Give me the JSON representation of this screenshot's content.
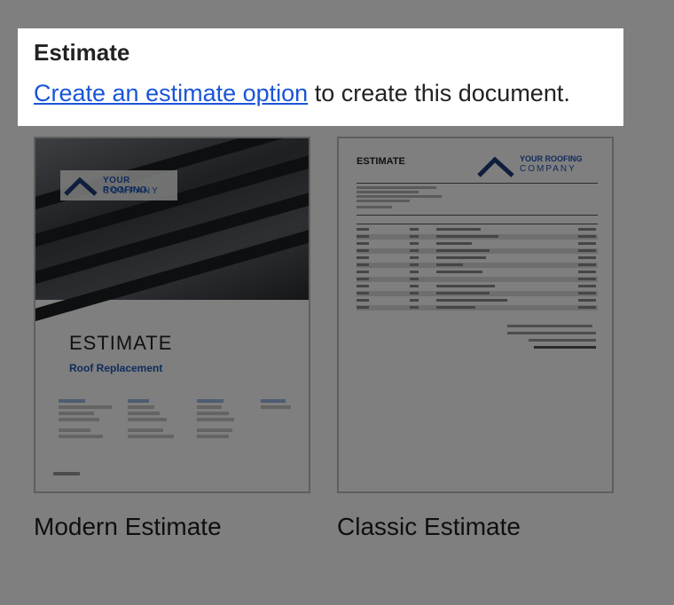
{
  "callout": {
    "title": "Estimate",
    "link_text": "Create an estimate option",
    "rest_text": " to create this document."
  },
  "templates": [
    {
      "name": "Modern Estimate"
    },
    {
      "name": "Classic Estimate"
    }
  ],
  "modern_preview": {
    "logo_line1": "YOUR ROOFING",
    "logo_line2": "COMPANY",
    "title": "ESTIMATE",
    "subtitle": "Roof Replacement"
  },
  "classic_preview": {
    "title": "ESTIMATE",
    "logo_line1": "YOUR ROOFING",
    "logo_line2": "COMPANY"
  },
  "colors": {
    "link": "#1a55d6",
    "brand": "#1f56b8",
    "overlay": "rgba(0,0,0,0.5)"
  }
}
